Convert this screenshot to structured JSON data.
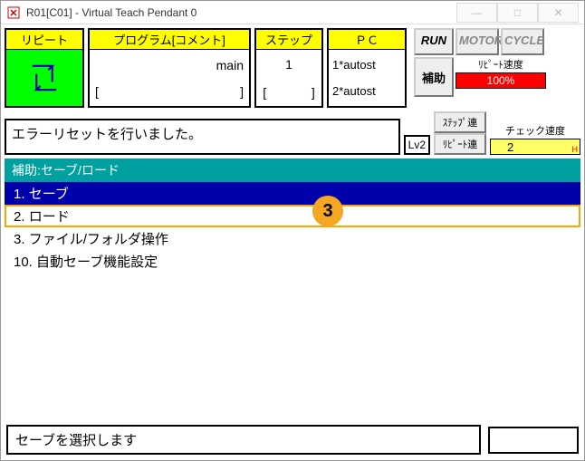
{
  "window": {
    "title": "R01[C01] - Virtual Teach Pendant 0"
  },
  "top": {
    "repeat_label": "リピート",
    "program_header": "プログラム[コメント]",
    "program_name": "main",
    "program_bracket_l": "[",
    "program_bracket_r": "]",
    "step_header": "ステップ",
    "step_value": "1",
    "step_bracket_l": "[",
    "step_bracket_r": "]",
    "pc_header": "ＰＣ",
    "pc_line1": "1*autost",
    "pc_line2": "2*autost"
  },
  "right": {
    "run": "RUN",
    "motor": "MOTOR",
    "cycle": "CYCLE",
    "hojo": "補助",
    "repeat_speed_label": "ﾘﾋﾟｰﾄ速度",
    "repeat_speed_value": "100%",
    "check_speed_label": "チェック速度",
    "check_speed_value": "2",
    "step_ren": "ｽﾃｯﾌﾟ連",
    "repeat_ren": "ﾘﾋﾟｰﾄ連"
  },
  "message": "エラーリセットを行いました。",
  "lv": "Lv2",
  "sub_header": "補助:セーブ/ロード",
  "menu": {
    "items": [
      {
        "num": "1.",
        "label": "セーブ"
      },
      {
        "num": "2.",
        "label": "ロード"
      },
      {
        "num": "3.",
        "label": "ファイル/フォルダ操作"
      },
      {
        "num": "10.",
        "label": "自動セーブ機能設定"
      }
    ]
  },
  "callout": "3",
  "prompt": "セーブを選択します"
}
